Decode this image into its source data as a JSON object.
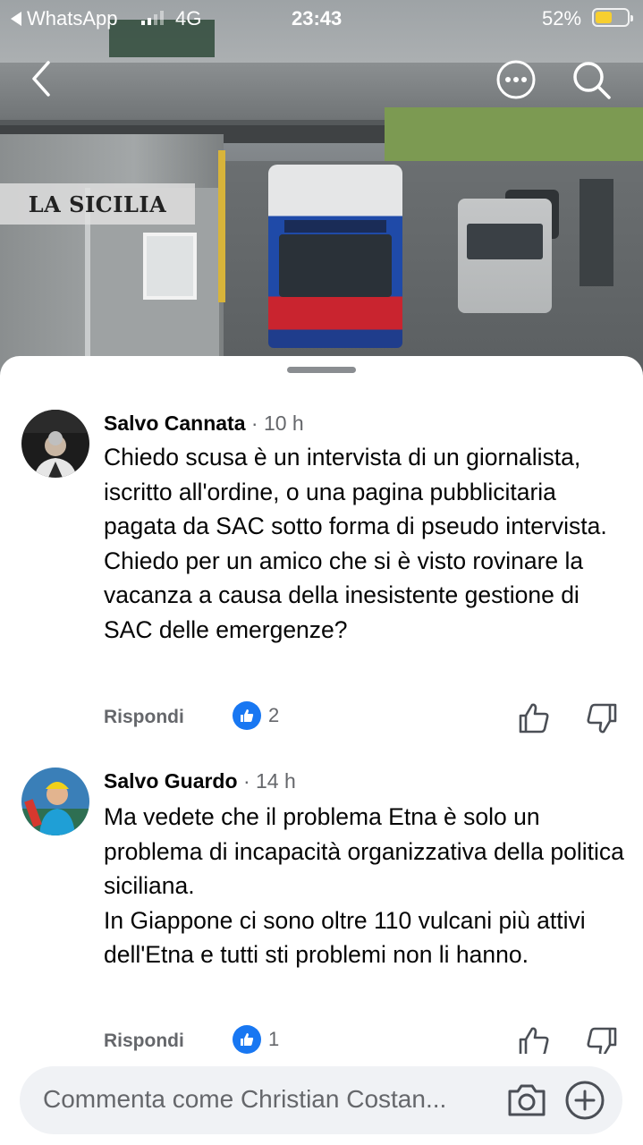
{
  "status_bar": {
    "back_app": "WhatsApp",
    "network": "4G",
    "time": "23:43",
    "battery_percent": "52%",
    "battery_level": 0.52,
    "battery_color": "#f7cf2f"
  },
  "media": {
    "logo_text": "LA SICILIA"
  },
  "comments": [
    {
      "author": "Salvo Cannata",
      "time": "· 10 h",
      "text": "Chiedo scusa è un intervista di un giornalista, iscritto all'ordine, o una pagina pubblicitaria pagata da SAC sotto forma di pseudo intervista. Chiedo per un amico che si è visto rovinare la vacanza a causa della inesistente gestione di SAC delle emergenze?",
      "reply_label": "Rispondi",
      "like_count": "2"
    },
    {
      "author": "Salvo Guardo",
      "time": "· 14 h",
      "text": "Ma vedete che il problema Etna è solo un problema di incapacità organizzativa della politica siciliana.\nIn Giappone ci sono oltre 110 vulcani più attivi dell'Etna e tutti sti problemi non li hanno.",
      "reply_label": "Rispondi",
      "like_count": "1"
    }
  ],
  "composer": {
    "placeholder": "Commenta come Christian Costan..."
  },
  "colors": {
    "accent": "#1877f2",
    "secondary_text": "#65676b"
  }
}
